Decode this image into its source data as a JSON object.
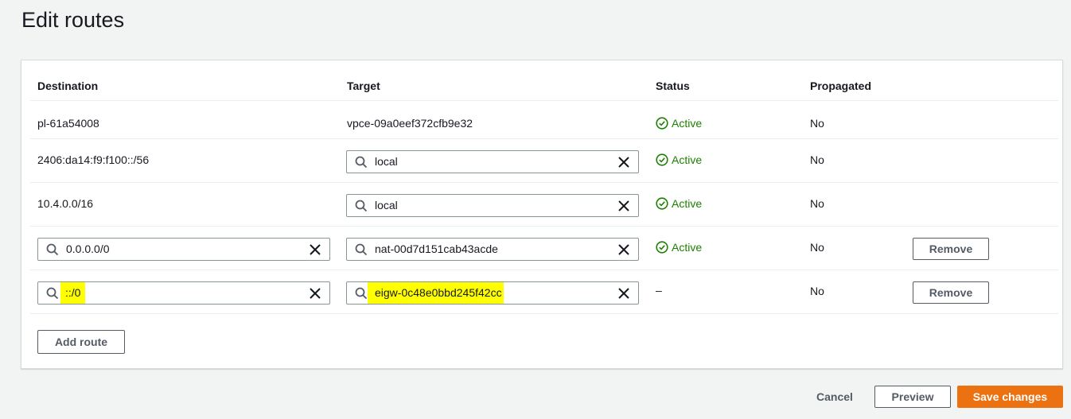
{
  "page": {
    "title": "Edit routes"
  },
  "columns": {
    "destination": "Destination",
    "target": "Target",
    "status": "Status",
    "propagated": "Propagated"
  },
  "routes": [
    {
      "destination": "pl-61a54008",
      "target": "vpce-09a0eef372cfb9e32",
      "status": "Active",
      "propagated": "No"
    },
    {
      "destination": "2406:da14:f9:f100::/56",
      "target": "local",
      "status": "Active",
      "propagated": "No"
    },
    {
      "destination": "10.4.0.0/16",
      "target": "local",
      "status": "Active",
      "propagated": "No"
    },
    {
      "destination": "0.0.0.0/0",
      "target": "nat-00d7d151cab43acde",
      "status": "Active",
      "propagated": "No",
      "remove_label": "Remove"
    },
    {
      "destination": "::/0",
      "target": "eigw-0c48e0bbd245f42cc",
      "status": "–",
      "propagated": "No",
      "remove_label": "Remove"
    }
  ],
  "actions": {
    "add_route": "Add route",
    "cancel": "Cancel",
    "preview": "Preview",
    "save": "Save changes"
  },
  "colors": {
    "accent": "#ec7211",
    "status_active": "#1d8102",
    "highlight": "#ffff00"
  },
  "icons": {
    "search": "search-icon",
    "clear": "close-icon",
    "status": "check-circle-icon"
  }
}
